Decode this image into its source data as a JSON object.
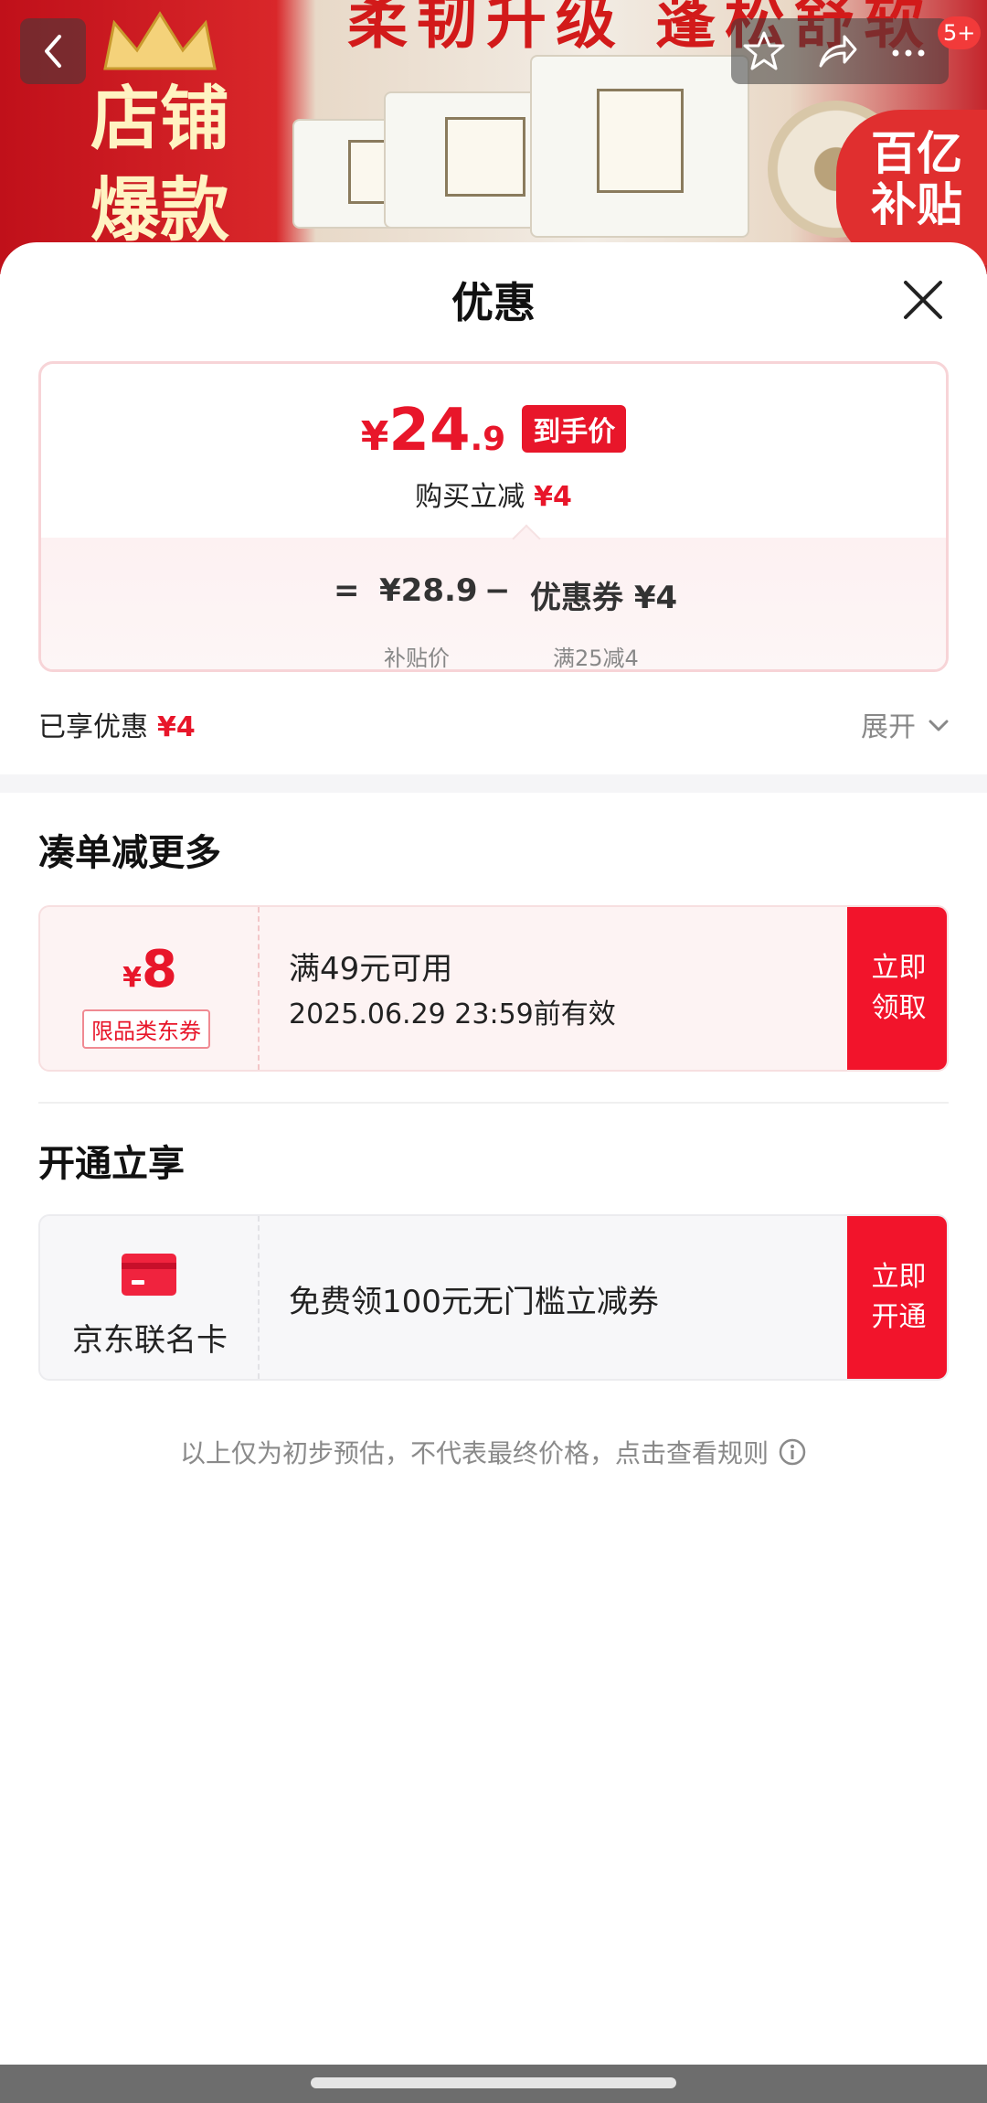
{
  "background": {
    "banner_text": "柔韧升级 蓬松舒软",
    "store_text_line1": "店铺",
    "store_text_line2": "爆款",
    "badge_line1": "百亿",
    "badge_line2": "补贴",
    "notification_count": "5+"
  },
  "sheet": {
    "title": "优惠"
  },
  "price_card": {
    "currency": "¥",
    "final_price_int": "24",
    "final_price_dec": ".9",
    "final_price_tag": "到手价",
    "instant_reduce_label": "购买立减",
    "instant_reduce_value": "¥4",
    "equals": "=",
    "subsidy_price": "¥28.9",
    "minus": "−",
    "coupon_label": "优惠券 ¥4",
    "subsidy_price_label": "补贴价",
    "coupon_condition": "满25减4"
  },
  "enjoyed": {
    "label": "已享优惠",
    "value": "¥4",
    "expand_label": "展开"
  },
  "section_more": {
    "title": "凑单减更多",
    "coupon": {
      "currency": "¥",
      "amount": "8",
      "type": "限品类东券",
      "condition": "满49元可用",
      "valid_until": "2025.06.29 23:59前有效",
      "button_line1": "立即",
      "button_line2": "领取"
    }
  },
  "section_open": {
    "title": "开通立享",
    "card_name": "京东联名卡",
    "offer": "免费领100元无门槛立减券",
    "button_line1": "立即",
    "button_line2": "开通"
  },
  "disclaimer": "以上仅为初步预估，不代表最终价格，点击查看规则",
  "colors": {
    "accent_red": "#e8162a",
    "button_red": "#f2142b"
  }
}
